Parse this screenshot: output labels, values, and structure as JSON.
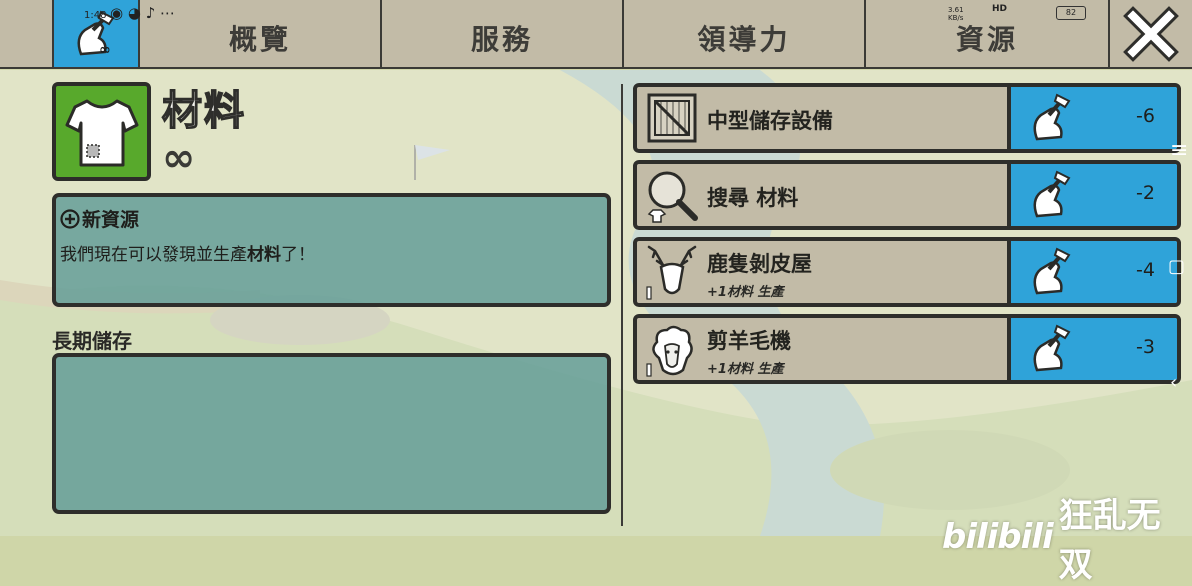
{
  "status_bar": {
    "time": "1:48",
    "speed": "3.61 KB/s",
    "network": "HD",
    "battery": "82"
  },
  "tabs": [
    {
      "label": ""
    },
    {
      "label": "概覽"
    },
    {
      "label": "服務"
    },
    {
      "label": "領導力"
    },
    {
      "label": "資源"
    }
  ],
  "resource": {
    "name": "材料",
    "amount": "∞"
  },
  "new_resource": {
    "title": "新資源",
    "text_before": "我們現在可以發現並生產",
    "text_bold": "材料",
    "text_after": "了！"
  },
  "storage": {
    "title": "長期儲存"
  },
  "producers": [
    {
      "name": "中型儲存設備",
      "sub": "",
      "workers": "-6",
      "icon": "crate-icon"
    },
    {
      "name": "搜尋 材料",
      "sub": "",
      "workers": "-2",
      "icon": "magnifier-shirt-icon"
    },
    {
      "name": "鹿隻剝皮屋",
      "sub": "+1材料 生產",
      "workers": "-4",
      "icon": "deer-head-icon"
    },
    {
      "name": "剪羊毛機",
      "sub": "+1材料 生產",
      "workers": "-3",
      "icon": "sheep-head-icon"
    }
  ],
  "watermark": {
    "logo": "bilibili",
    "author": "狂乱无双"
  },
  "colors": {
    "active_tab": "#2fa3d9",
    "tab": "#c2bba7",
    "material_green": "#58a92c",
    "panel_teal": "#5f9b96"
  }
}
